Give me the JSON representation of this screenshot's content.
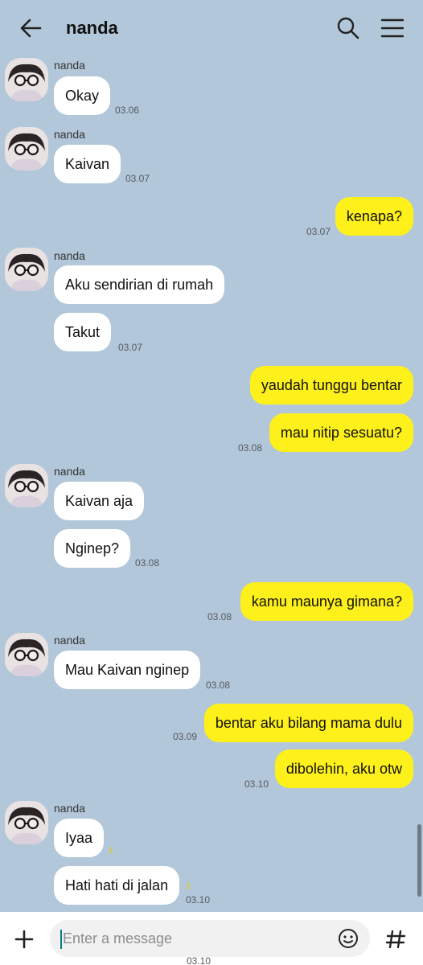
{
  "header": {
    "title": "nanda"
  },
  "groups": [
    {
      "sender": "nanda",
      "messages": [
        "Okay"
      ],
      "time": "03.06"
    },
    {
      "sender": "nanda",
      "messages": [
        "Kaivan"
      ],
      "time": "03.07"
    },
    {
      "sender": "nanda",
      "messages": [
        "Aku sendirian di rumah",
        "Takut"
      ],
      "time": "03.07"
    },
    {
      "sender": "nanda",
      "messages": [
        "Kaivan aja",
        "Nginep?"
      ],
      "time": "03.08"
    },
    {
      "sender": "nanda",
      "messages": [
        "Mau Kaivan nginep"
      ],
      "time": "03.08"
    },
    {
      "sender": "nanda",
      "messages": [
        "Iyaa",
        "Hati hati di jalan"
      ],
      "time": "03.10",
      "read_marks": [
        "1",
        "1"
      ]
    }
  ],
  "outgoing": [
    {
      "text": "kenapa?",
      "time": "03.07"
    },
    {
      "text": "yaudah tunggu bentar"
    },
    {
      "text": "mau nitip sesuatu?",
      "time": "03.08"
    },
    {
      "text": "kamu maunya gimana?",
      "time": "03.08"
    },
    {
      "text": "bentar aku bilang mama dulu",
      "time": "03.09"
    },
    {
      "text": "dibolehin, aku otw",
      "time": "03.10"
    }
  ],
  "input": {
    "placeholder": "Enter a message"
  },
  "peek_time": "03.10",
  "colors": {
    "background": "#b2c7d9",
    "outgoing_bubble": "#fef01b",
    "incoming_bubble": "#ffffff"
  }
}
